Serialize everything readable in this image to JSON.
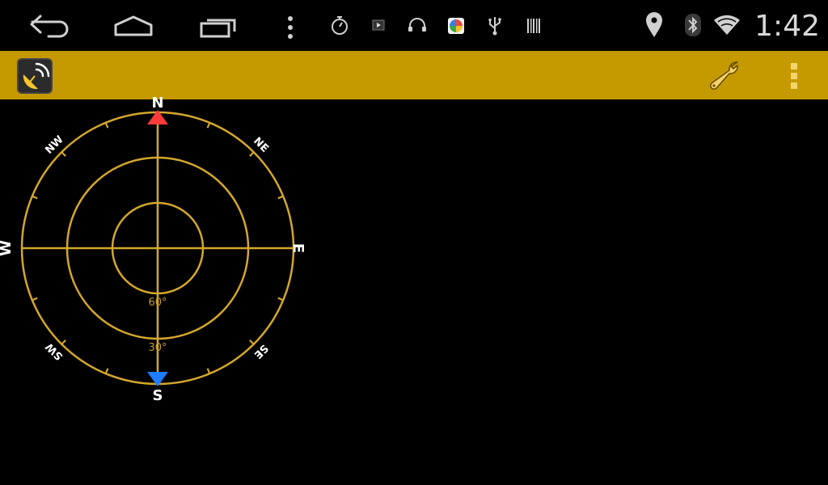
{
  "status_bar": {
    "time": "1:42",
    "icons": [
      "back-icon",
      "home-icon",
      "recent-apps-icon",
      "menu-dots-icon",
      "stopwatch-icon",
      "media-play-icon",
      "headset-icon",
      "photo-app-icon",
      "usb-icon",
      "barcode-icon",
      "location-pin-icon",
      "bluetooth-icon",
      "wifi-icon"
    ]
  },
  "app_bar": {
    "color": "#c49a00",
    "logo_icon": "satellite-dish-icon",
    "settings_icon": "wrench-icon",
    "overflow_icon": "overflow-menu-icon"
  },
  "compass": {
    "ring_color": "#d4a72c",
    "directions": {
      "n": "N",
      "s": "S",
      "e": "E",
      "w": "W",
      "ne": "NE",
      "nw": "NW",
      "se": "SE",
      "sw": "SW"
    },
    "elevations": {
      "inner": "60°",
      "middle": "30°"
    },
    "north_marker_color": "#ff3b3b",
    "south_marker_color": "#1e7cff"
  }
}
